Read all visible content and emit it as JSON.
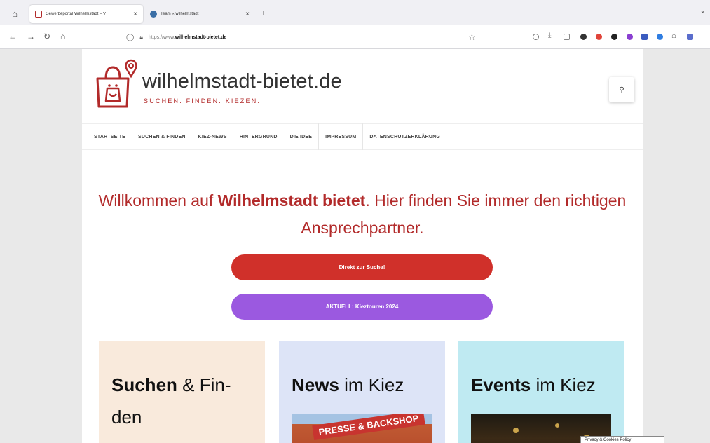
{
  "browser": {
    "tabs": [
      {
        "title": "Gewerbeportal Wilhelmstadt – V",
        "active": true
      },
      {
        "title": "Team « wilhelmstadt",
        "active": false
      }
    ],
    "url_prefix": "https://www.",
    "url_domain": "wilhelmstadt-bietet.de",
    "icons": {
      "tab_overview": "tab-overview-icon",
      "back": "arrow-left-icon",
      "forward": "arrow-right-icon",
      "reload": "reload-icon",
      "home": "home-icon",
      "shield": "shield-icon",
      "lock": "lock-icon",
      "bookmark": "star-icon"
    }
  },
  "site": {
    "brand": "wilhelmstadt-bietet.de",
    "tagline": "SUCHEN. FINDEN. KIEZEN.",
    "menu": [
      {
        "label": "STARTSEITE"
      },
      {
        "label": "SUCHEN & FINDEN"
      },
      {
        "label": "KIEZ-NEWS"
      },
      {
        "label": "HINTERGRUND"
      },
      {
        "label": "DIE IDEE"
      },
      {
        "label": "IMPRESSUM",
        "active": true
      },
      {
        "label": "DATENSCHUTZERKLÄRUNG"
      }
    ],
    "welcome": {
      "part1": "Willkommen auf ",
      "bold": "Wilhelmstadt bietet",
      "part2": ". Hier finden Sie immer den richtigen Ansprechpartner."
    },
    "cta_primary": "Direkt zur Suche!",
    "cta_secondary": "AKTUELL: Kieztouren 2024",
    "cards": [
      {
        "bold": "Suchen",
        "rest": " & Fin-den"
      },
      {
        "bold": "News",
        "rest": " im Kiez",
        "image_text": "PRESSE & BACKSHOP"
      },
      {
        "bold": "Events",
        "rest": " im Kiez"
      }
    ],
    "tooltip": "Privacy & Cookies Policy"
  },
  "colors": {
    "brand_red": "#b22a2a",
    "cta_red": "#d0302a",
    "cta_purple": "#9b59e0",
    "card1_bg": "#f9eadc",
    "card2_bg": "#dde4f7",
    "card3_bg": "#bfeaf2"
  }
}
